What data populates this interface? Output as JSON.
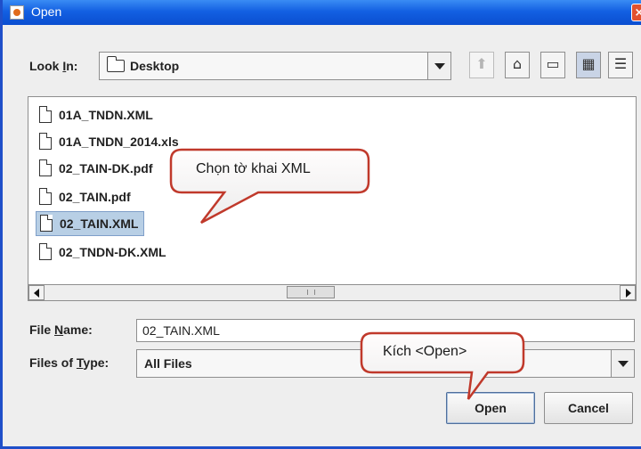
{
  "window": {
    "title": "Open",
    "close_glyph": "×"
  },
  "look_in": {
    "label_prefix": "Look ",
    "label_mnemonic": "I",
    "label_suffix": "n:",
    "value": "Desktop"
  },
  "toolbar": [
    {
      "name": "up-folder-icon",
      "glyph": "⬆",
      "disabled": true
    },
    {
      "name": "home-icon",
      "glyph": "⌂",
      "disabled": false
    },
    {
      "name": "new-folder-icon",
      "glyph": "▭",
      "disabled": false
    },
    {
      "name": "list-view-icon",
      "glyph": "▦",
      "selected": true
    },
    {
      "name": "details-view-icon",
      "glyph": "☰",
      "selected": false
    }
  ],
  "files": [
    "01A_TNDN.XML",
    "01A_TNDN_2014.xls",
    "02_TAIN-DK.pdf",
    "02_TAIN.pdf",
    "02_TAIN.XML",
    "02_TNDN-DK.XML"
  ],
  "selected_file_index": 4,
  "file_name": {
    "label_prefix": "File ",
    "label_mnemonic": "N",
    "label_suffix": "ame:",
    "value": "02_TAIN.XML"
  },
  "file_type": {
    "label_prefix": "Files of ",
    "label_mnemonic": "T",
    "label_suffix": "ype:",
    "value": "All Files"
  },
  "buttons": {
    "open": "Open",
    "cancel": "Cancel"
  },
  "callouts": {
    "select_xml": "Chọn tờ khai XML",
    "click_open": "Kích <Open>"
  },
  "colors": {
    "titlebar": "#1360e2",
    "callout_border": "#c0392b",
    "selection": "#b8cfe5"
  }
}
